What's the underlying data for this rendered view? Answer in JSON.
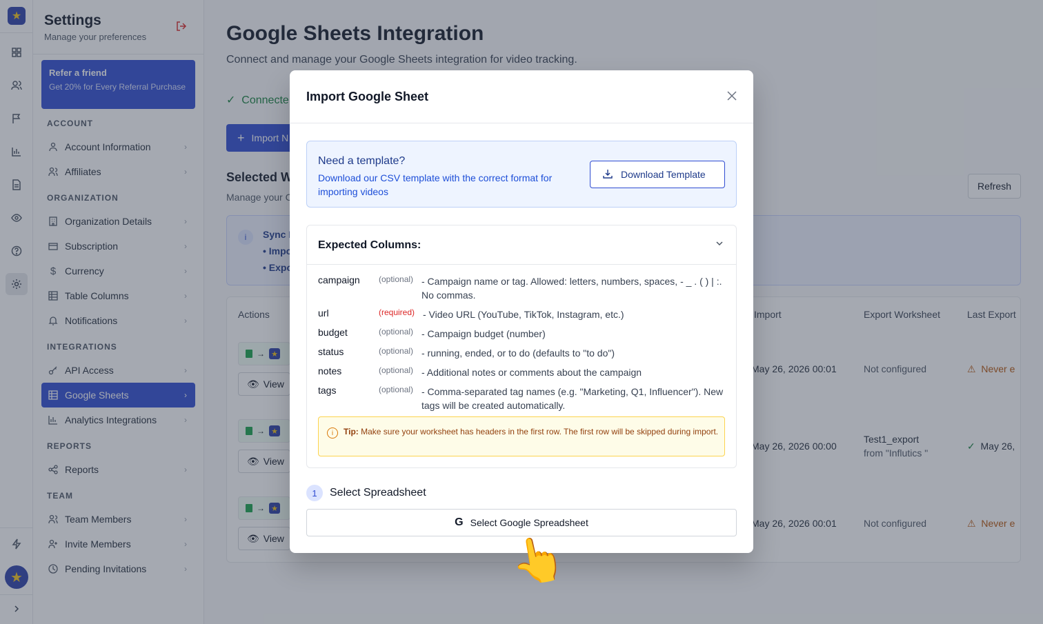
{
  "sidebar": {
    "title": "Settings",
    "subtitle": "Manage your preferences",
    "referral": {
      "title": "Refer a friend",
      "text": "Get 20% for Every Referral Purchase"
    },
    "sections": {
      "account": "ACCOUNT",
      "organization": "ORGANIZATION",
      "integrations": "INTEGRATIONS",
      "reports": "REPORTS",
      "team": "TEAM"
    },
    "items": {
      "account_information": "Account Information",
      "affiliates": "Affiliates",
      "organization_details": "Organization Details",
      "subscription": "Subscription",
      "currency": "Currency",
      "table_columns": "Table Columns",
      "notifications": "Notifications",
      "api_access": "API Access",
      "google_sheets": "Google Sheets",
      "analytics_integrations": "Analytics Integrations",
      "reports": "Reports",
      "team_members": "Team Members",
      "invite_members": "Invite Members",
      "pending_invitations": "Pending Invitations"
    }
  },
  "main": {
    "title": "Google Sheets Integration",
    "subtitle": "Connect and manage your Google Sheets integration for video tracking.",
    "connected": "Connecte",
    "import_button": "Import N",
    "selected_title": "Selected W",
    "selected_subtitle": "Manage your C",
    "refresh": "Refresh",
    "sync": {
      "title": "Sync I",
      "line1": "• Impo",
      "line2": "• Expo"
    },
    "table": {
      "headers": {
        "actions": "Actions",
        "import": "Import",
        "export_ws": "Export Worksheet",
        "last_export": "Last Export"
      },
      "view_label": "View",
      "rows": [
        {
          "import_date": "May 26, 2026 00:01",
          "export_ws": "Not configured",
          "export_from": "",
          "last_export": "Never e"
        },
        {
          "import_date": "May 26, 2026 00:00",
          "export_ws": "Test1_export",
          "export_from": "from \"Influtics \"",
          "last_export": "May 26,"
        },
        {
          "import_date": "May 26, 2026 00:01",
          "export_ws": "Not configured",
          "export_from": "",
          "last_export": "Never e"
        }
      ]
    }
  },
  "modal": {
    "title": "Import Google Sheet",
    "template": {
      "title": "Need a template?",
      "text": "Download our CSV template with the correct format for importing videos",
      "button": "Download Template"
    },
    "expected_title": "Expected Columns:",
    "columns": [
      {
        "name": "campaign",
        "flag": "(optional)",
        "desc": "- Campaign name or tag. Allowed: letters, numbers, spaces, - _ . ( ) | :. No commas."
      },
      {
        "name": "url",
        "flag": "(required)",
        "desc": "- Video URL (YouTube, TikTok, Instagram, etc.)"
      },
      {
        "name": "budget",
        "flag": "(optional)",
        "desc": "- Campaign budget (number)"
      },
      {
        "name": "status",
        "flag": "(optional)",
        "desc": "- running, ended, or to do (defaults to \"to do\")"
      },
      {
        "name": "notes",
        "flag": "(optional)",
        "desc": "- Additional notes or comments about the campaign"
      },
      {
        "name": "tags",
        "flag": "(optional)",
        "desc": "- Comma-separated tag names (e.g. \"Marketing, Q1, Influencer\"). New tags will be created automatically."
      }
    ],
    "tip_label": "Tip:",
    "tip_text": "Make sure your worksheet has headers in the first row. The first row will be skipped during import.",
    "step_number": "1",
    "step_label": "Select Spreadsheet",
    "select_button": "Select Google Spreadsheet",
    "google_glyph": "G"
  },
  "colors": {
    "accent": "#2f4bd1",
    "success": "#15803d",
    "warning": "#d97706",
    "danger": "#dc2626"
  }
}
